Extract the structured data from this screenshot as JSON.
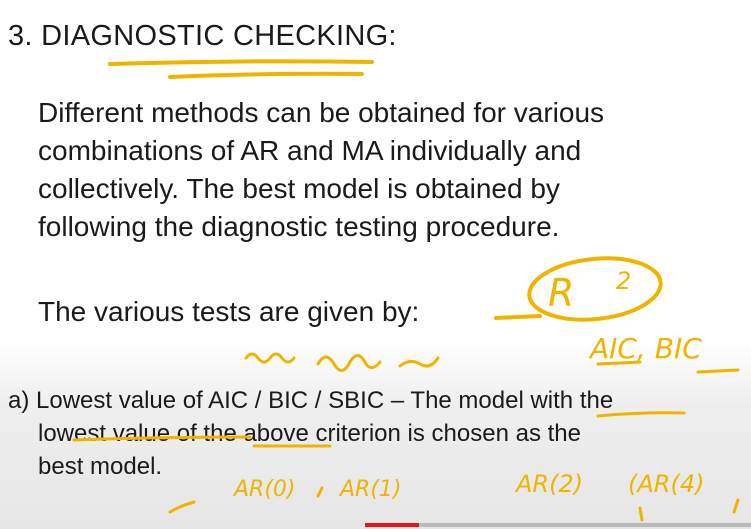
{
  "slide": {
    "heading": "3. DIAGNOSTIC CHECKING:",
    "paragraph_lines": [
      "Different methods can be obtained for various",
      "combinations of AR and MA individually and",
      "collectively. The best model is obtained by",
      "following the diagnostic testing procedure."
    ],
    "tests_intro": "The various tests are given by:",
    "item_a_lines": [
      "a) Lowest value of AIC / BIC / SBIC – The model with the",
      "lowest value of the above criterion is chosen as the",
      "best model."
    ]
  },
  "annotations": {
    "r_squared": "R",
    "r_squared_exponent": "2",
    "aic_bic": "AIC, BIC",
    "ar_models": [
      "AR(0)",
      "AR(1)",
      "AR(2)",
      "(AR(4)"
    ]
  },
  "colors": {
    "ink": "#f0b400",
    "progress": "#e8141b"
  },
  "video": {
    "progress_fraction": 0.14
  }
}
